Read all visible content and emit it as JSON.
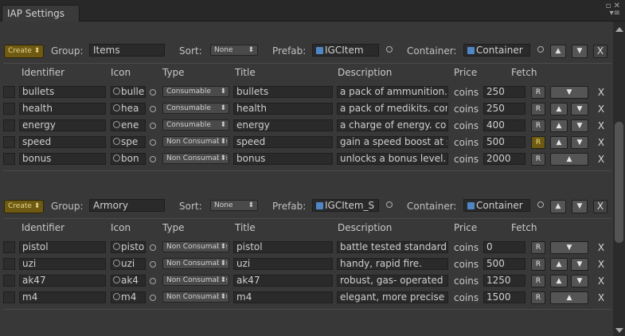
{
  "window": {
    "tab_title": "IAP Settings",
    "controls": "▫ ✕\n▾≡"
  },
  "icons": {
    "up": "▲",
    "down": "▼",
    "close": "X",
    "dropdown": "⬍"
  },
  "colors": {
    "create_button": "#6e5a12",
    "object_icon": "#4f86c6",
    "active_fetch": "#6e5a12"
  },
  "labels": {
    "create": "Create ⬍",
    "group": "Group:",
    "sort": "Sort:",
    "prefab": "Prefab:",
    "container": "Container:",
    "fetch_button": "R"
  },
  "columns": [
    "Identifier",
    "Icon",
    "Type",
    "Title",
    "Description",
    "Price",
    "Fetch"
  ],
  "groups": [
    {
      "name": "Items",
      "sort": "None",
      "prefab": "IGCItem",
      "container": "Container",
      "items": [
        {
          "identifier": "bullets",
          "icon": "bulle",
          "type": "Consumable",
          "title": "bullets",
          "description": "a pack of ammunition.",
          "currency": "coins",
          "price": "250",
          "fetch_active": false,
          "buttons": "down"
        },
        {
          "identifier": "health",
          "icon": "hea",
          "type": "Consumable",
          "title": "health",
          "description": "a pack of medikits. cont",
          "currency": "coins",
          "price": "250",
          "fetch_active": false,
          "buttons": "both"
        },
        {
          "identifier": "energy",
          "icon": "ene",
          "type": "Consumable",
          "title": "energy",
          "description": "a charge of energy. co",
          "currency": "coins",
          "price": "400",
          "fetch_active": false,
          "buttons": "both"
        },
        {
          "identifier": "speed",
          "icon": "spe",
          "type": "Non Consumable",
          "title": "speed",
          "description": "gain a speed boost at s",
          "currency": "coins",
          "price": "500",
          "fetch_active": true,
          "buttons": "both"
        },
        {
          "identifier": "bonus",
          "icon": "bon",
          "type": "Non Consumable",
          "title": "bonus",
          "description": "unlocks a bonus level.",
          "currency": "coins",
          "price": "2000",
          "fetch_active": false,
          "buttons": "up"
        }
      ]
    },
    {
      "name": "Armory",
      "sort": "None",
      "prefab": "IGCItem_S",
      "container": "Container",
      "items": [
        {
          "identifier": "pistol",
          "icon": "pisto",
          "type": "Non Consumable",
          "title": "pistol",
          "description": "battle tested standard.",
          "currency": "coins",
          "price": "0",
          "fetch_active": false,
          "buttons": "down"
        },
        {
          "identifier": "uzi",
          "icon": "uzi",
          "type": "Non Consumable",
          "title": "uzi",
          "description": "handy, rapid fire.",
          "currency": "coins",
          "price": "500",
          "fetch_active": false,
          "buttons": "both"
        },
        {
          "identifier": "ak47",
          "icon": "ak4",
          "type": "Non Consumable",
          "title": "ak47",
          "description": "robust, gas- operated",
          "currency": "coins",
          "price": "1250",
          "fetch_active": false,
          "buttons": "both"
        },
        {
          "identifier": "m4",
          "icon": "m4",
          "type": "Non Consumable",
          "title": "m4",
          "description": "elegant, more precise",
          "currency": "coins",
          "price": "1500",
          "fetch_active": false,
          "buttons": "up"
        }
      ]
    }
  ]
}
